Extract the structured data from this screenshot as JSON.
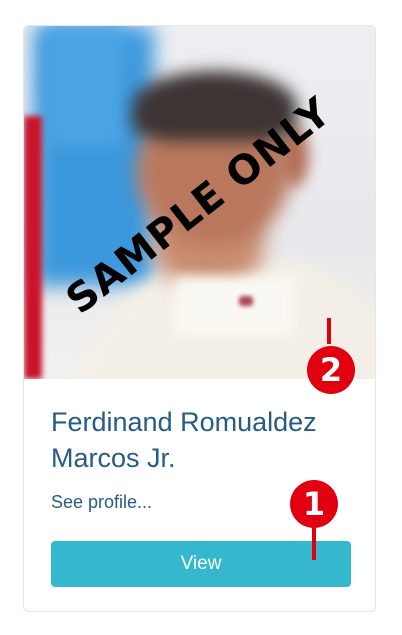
{
  "card": {
    "image_watermark": "SAMPLE ONLY",
    "name": "Ferdinand Romualdez Marcos Jr.",
    "see_profile": "See profile...",
    "view_button": "View"
  },
  "annotations": {
    "marker_1": "1",
    "marker_2": "2"
  },
  "colors": {
    "name_text": "#265b86",
    "button_bg": "#35b8cd",
    "marker": "#e0000f"
  }
}
